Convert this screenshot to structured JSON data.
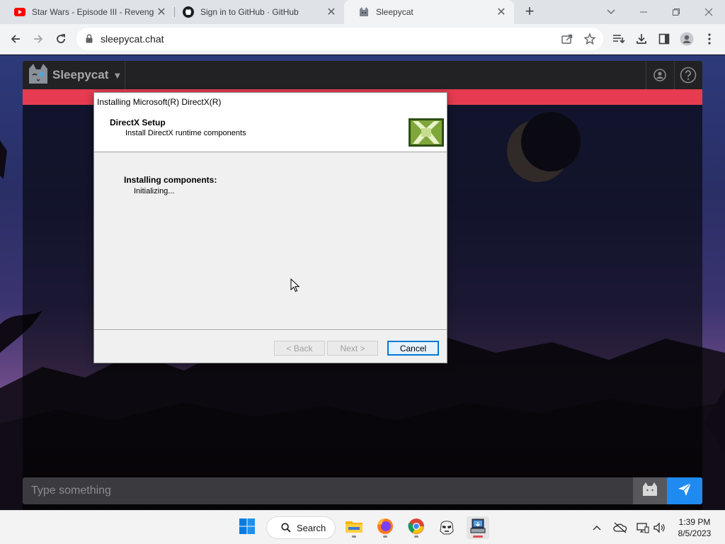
{
  "browser": {
    "tabs": [
      {
        "title": "Star Wars - Episode III - Revenge",
        "icon": "youtube-icon",
        "active": false
      },
      {
        "title": "Sign in to GitHub · GitHub",
        "icon": "github-icon",
        "active": false
      },
      {
        "title": "Sleepycat",
        "icon": "sleepycat-icon",
        "active": true
      }
    ],
    "url": "sleepycat.chat"
  },
  "app": {
    "brand": "Sleepycat",
    "input_placeholder": "Type something",
    "stripe_color": "#e63b50",
    "send_color": "#1f8bf0"
  },
  "dialog": {
    "title": "Installing Microsoft(R) DirectX(R)",
    "header_title": "DirectX Setup",
    "header_subtitle": "Install DirectX runtime components",
    "status_label": "Installing components:",
    "status_detail": "Initializing...",
    "back_label": "< Back",
    "next_label": "Next >",
    "cancel_label": "Cancel"
  },
  "taskbar": {
    "search_label": "Search",
    "time": "1:39 PM",
    "date": "8/5/2023"
  }
}
